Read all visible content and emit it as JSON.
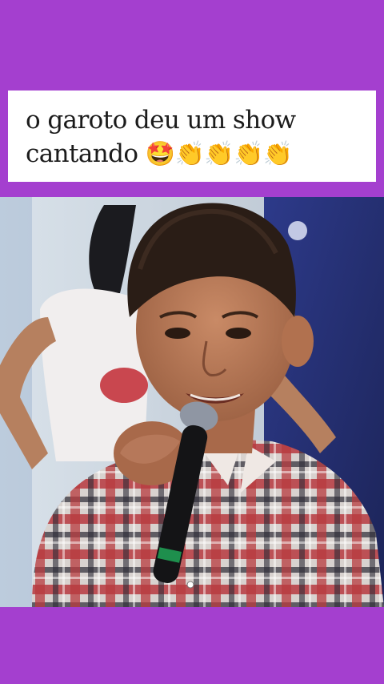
{
  "caption": {
    "line1": "o garoto deu um show",
    "line2": "cantando",
    "emojis": "🤩👏👏👏👏"
  },
  "colors": {
    "background": "#a43fcf",
    "caption_bg": "#ffffff",
    "caption_text": "#1b1b1b"
  },
  "video": {
    "subject": "boy-singing-with-microphone"
  }
}
